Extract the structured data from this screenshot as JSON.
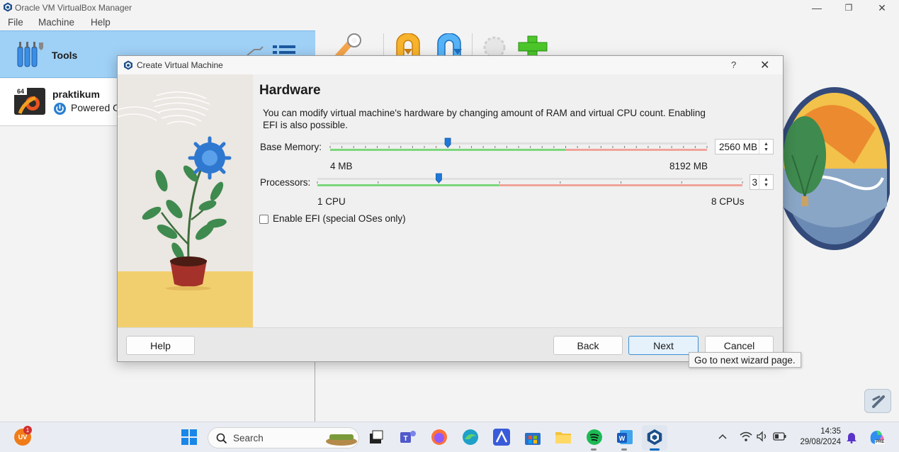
{
  "window": {
    "title": "Oracle VM VirtualBox Manager",
    "controls": {
      "minimize": "—",
      "restore": "❐",
      "close": "✕"
    }
  },
  "menu": [
    "File",
    "Machine",
    "Help"
  ],
  "sidebar": {
    "tools_label": "Tools",
    "vm": {
      "name": "praktikum",
      "state": "Powered O",
      "badge": "64"
    }
  },
  "dialog": {
    "title": "Create Virtual Machine",
    "help_glyph": "?",
    "close_glyph": "✕",
    "heading": "Hardware",
    "description": "You can modify virtual machine's hardware by changing amount of RAM and virtual CPU count. Enabling EFI is also possible.",
    "memory": {
      "label": "Base Memory:",
      "min_label": "4 MB",
      "max_label": "8192 MB",
      "value_text": "2560 MB",
      "min": 4,
      "max": 8192,
      "value": 2560,
      "recommended_max": 5120
    },
    "processors": {
      "label": "Processors:",
      "min_label": "1 CPU",
      "max_label": "8 CPUs",
      "value_text": "3",
      "min": 1,
      "max": 8,
      "value": 3,
      "recommended_max": 4
    },
    "efi": {
      "label": "Enable EFI (special OSes only)",
      "checked": false
    },
    "buttons": {
      "help": "Help",
      "back": "Back",
      "next": "Next",
      "cancel": "Cancel"
    },
    "tooltip": "Go to next wizard page."
  },
  "taskbar": {
    "search_placeholder": "Search",
    "time": "14:35",
    "date": "29/08/2024",
    "notification_count": "1",
    "user_initials": "UV",
    "copilot_badge": "PRE"
  },
  "colors": {
    "accent": "#0078d4",
    "slider_good": "#7cd67c",
    "slider_bad": "#f0a39a",
    "tools_bg": "#9fd0f6"
  }
}
